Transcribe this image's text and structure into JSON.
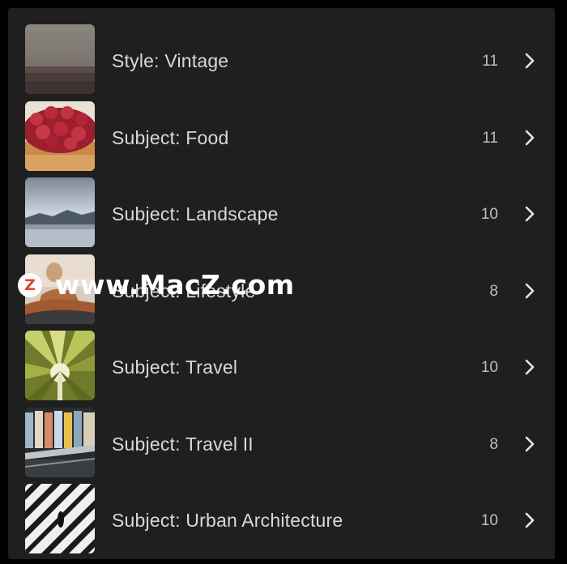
{
  "presets": [
    {
      "label": "Style: Vintage",
      "count": "11",
      "icon": "vintage-thumbnail"
    },
    {
      "label": "Subject: Food",
      "count": "11",
      "icon": "food-thumbnail"
    },
    {
      "label": "Subject: Landscape",
      "count": "10",
      "icon": "landscape-thumbnail"
    },
    {
      "label": "Subject: Lifestyle",
      "count": "8",
      "icon": "lifestyle-thumbnail"
    },
    {
      "label": "Subject: Travel",
      "count": "10",
      "icon": "travel-thumbnail"
    },
    {
      "label": "Subject: Travel II",
      "count": "8",
      "icon": "travel-ii-thumbnail"
    },
    {
      "label": "Subject: Urban Architecture",
      "count": "10",
      "icon": "urban-architecture-thumbnail"
    }
  ],
  "watermark": {
    "logo_letter": "Z",
    "text": "www.MacZ.com"
  },
  "colors": {
    "background": "#1f1f1f",
    "text": "#d9d9d9",
    "count": "#bdbdbd",
    "chevron": "#e6e6e6"
  }
}
